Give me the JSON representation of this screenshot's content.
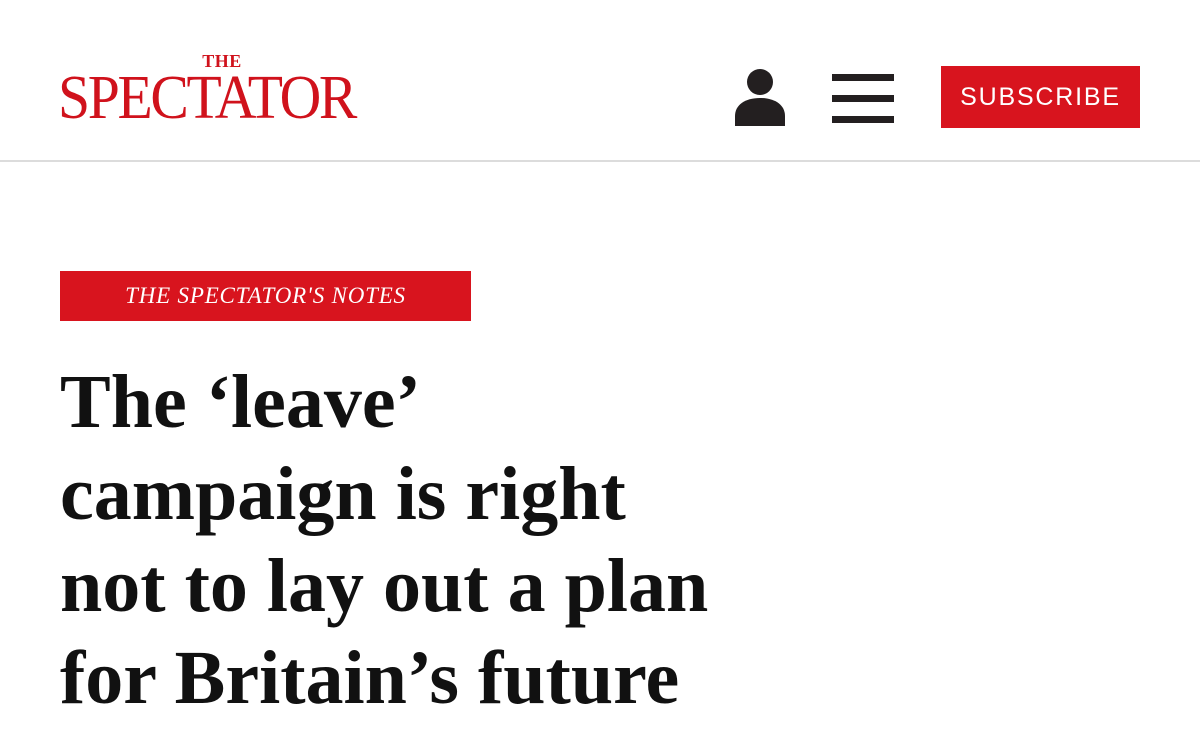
{
  "header": {
    "logo": {
      "the": "THE",
      "name": "SPECTATOR"
    },
    "subscribe_label": "SUBSCRIBE",
    "icons": {
      "account": "user-icon",
      "menu": "hamburger-menu-icon"
    }
  },
  "article": {
    "section_tag": "THE SPECTATOR'S NOTES",
    "headline_lines": [
      "The ‘leave’",
      "campaign is right",
      "not to lay out a plan",
      "for Britain’s future"
    ]
  },
  "colors": {
    "brand_red": "#d8141e",
    "text_dark": "#111111",
    "icon_dark": "#231f20",
    "divider": "#dcdcdc"
  }
}
